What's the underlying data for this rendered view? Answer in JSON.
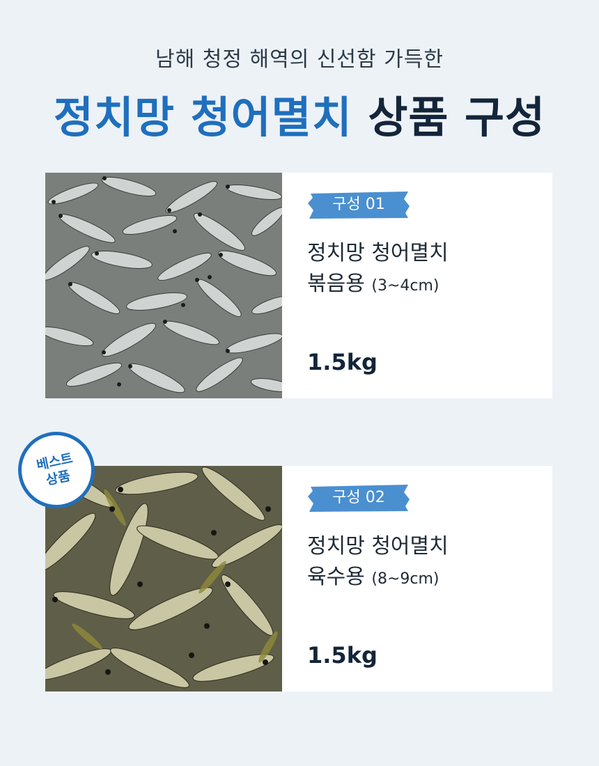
{
  "header": {
    "subtitle": "남해 청정 해역의 신선함 가득한",
    "title_accent": "정치망 청어멸치",
    "title_rest": "상품 구성"
  },
  "badge": {
    "line1": "베스트",
    "line2": "상품"
  },
  "products": [
    {
      "tag": "구성 01",
      "name_line1": "정치망 청어멸치",
      "name_line2": "볶음용",
      "size": "(3~4cm)",
      "weight": "1.5kg"
    },
    {
      "tag": "구성 02",
      "name_line1": "정치망 청어멸치",
      "name_line2": "육수용",
      "size": "(8~9cm)",
      "weight": "1.5kg"
    }
  ],
  "colors": {
    "accent": "#1f6fbd",
    "tag_bg": "#4a8fd0",
    "background": "#edf2f7"
  },
  "icons": [
    "dried-anchovy-photo",
    "best-product-stamp",
    "brush-stroke-tag"
  ]
}
